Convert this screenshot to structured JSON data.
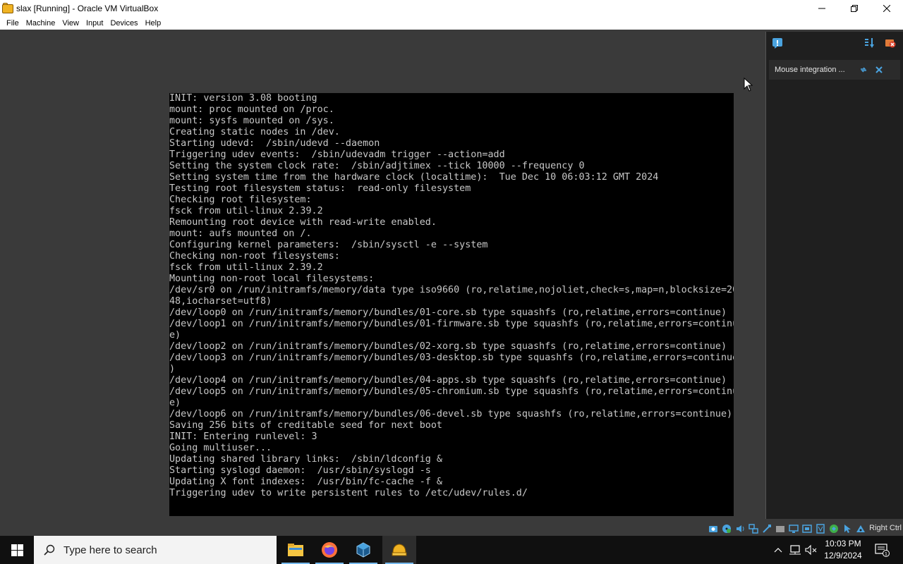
{
  "window": {
    "title": "slax [Running] - Oracle VM VirtualBox",
    "icon": "virtualbox-folder-icon"
  },
  "menubar": {
    "items": [
      "File",
      "Machine",
      "View",
      "Input",
      "Devices",
      "Help"
    ]
  },
  "console": {
    "lines": [
      "INIT: version 3.08 booting",
      "mount: proc mounted on /proc.",
      "mount: sysfs mounted on /sys.",
      "Creating static nodes in /dev.",
      "Starting udevd:  /sbin/udevd --daemon",
      "Triggering udev events:  /sbin/udevadm trigger --action=add",
      "Setting the system clock rate:  /sbin/adjtimex --tick 10000 --frequency 0",
      "Setting system time from the hardware clock (localtime):  Tue Dec 10 06:03:12 GMT 2024",
      "Testing root filesystem status:  read-only filesystem",
      "Checking root filesystem:",
      "fsck from util-linux 2.39.2",
      "Remounting root device with read-write enabled.",
      "mount: aufs mounted on /.",
      "Configuring kernel parameters:  /sbin/sysctl -e --system",
      "Checking non-root filesystems:",
      "fsck from util-linux 2.39.2",
      "Mounting non-root local filesystems:",
      "/dev/sr0 on /run/initramfs/memory/data type iso9660 (ro,relatime,nojoliet,check=s,map=n,blocksize=20",
      "48,iocharset=utf8)",
      "/dev/loop0 on /run/initramfs/memory/bundles/01-core.sb type squashfs (ro,relatime,errors=continue)",
      "/dev/loop1 on /run/initramfs/memory/bundles/01-firmware.sb type squashfs (ro,relatime,errors=continu",
      "e)",
      "/dev/loop2 on /run/initramfs/memory/bundles/02-xorg.sb type squashfs (ro,relatime,errors=continue)",
      "/dev/loop3 on /run/initramfs/memory/bundles/03-desktop.sb type squashfs (ro,relatime,errors=continue",
      ")",
      "/dev/loop4 on /run/initramfs/memory/bundles/04-apps.sb type squashfs (ro,relatime,errors=continue)",
      "/dev/loop5 on /run/initramfs/memory/bundles/05-chromium.sb type squashfs (ro,relatime,errors=continu",
      "e)",
      "/dev/loop6 on /run/initramfs/memory/bundles/06-devel.sb type squashfs (ro,relatime,errors=continue)",
      "Saving 256 bits of creditable seed for next boot",
      "INIT: Entering runlevel: 3",
      "Going multiuser...",
      "Updating shared library links:  /sbin/ldconfig &",
      "Starting syslogd daemon:  /usr/sbin/syslogd -s",
      "Updating X font indexes:  /usr/bin/fc-cache -f &",
      "Triggering udev to write persistent rules to /etc/udev/rules.d/"
    ]
  },
  "side_panel": {
    "notice_text": "Mouse integration ..."
  },
  "statusbar": {
    "host_key": "Right Ctrl"
  },
  "taskbar": {
    "search_placeholder": "Type here to search",
    "time": "10:03 PM",
    "date": "12/9/2024",
    "notification_count": "1"
  }
}
